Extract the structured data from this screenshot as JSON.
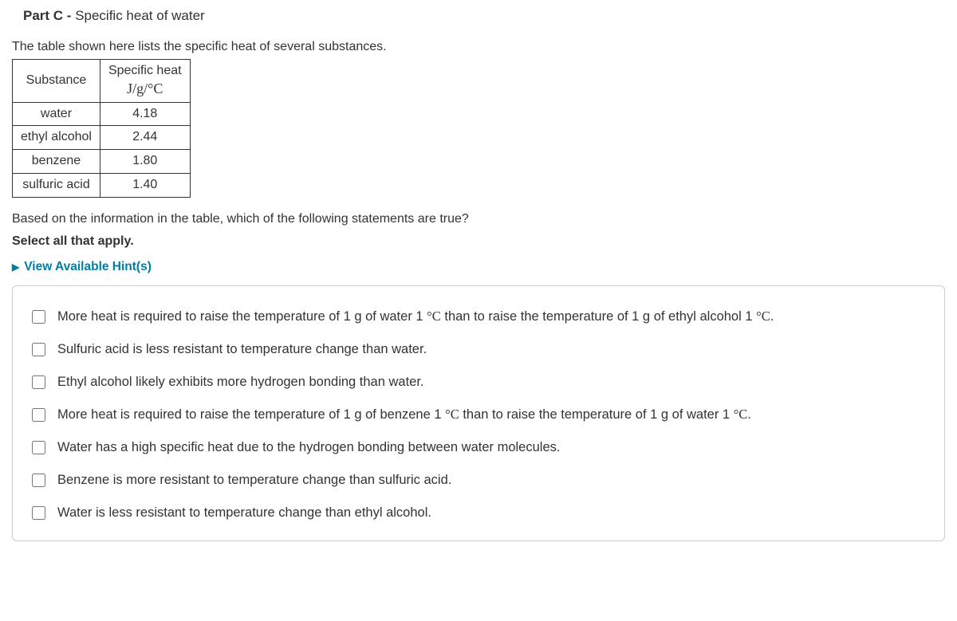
{
  "part": {
    "label": "Part C - ",
    "title": "Specific heat of water"
  },
  "intro": "The table shown here lists the specific heat of several substances.",
  "table": {
    "headers": {
      "substance": "Substance",
      "heat_line1": "Specific heat",
      "heat_unit_html": "J/g/°C"
    },
    "rows": [
      {
        "substance": "water",
        "value": "4.18"
      },
      {
        "substance": "ethyl alcohol",
        "value": "2.44"
      },
      {
        "substance": "benzene",
        "value": "1.80"
      },
      {
        "substance": "sulfuric acid",
        "value": "1.40"
      }
    ]
  },
  "question": "Based on the information in the table, which of the following statements are true?",
  "instruct": "Select all that apply.",
  "hints_label": "View Available Hint(s)",
  "options": [
    "More heat is required to raise the temperature of 1 g of water 1 °C than to raise the temperature of 1 g of ethyl alcohol 1 °C.",
    "Sulfuric acid is less resistant to temperature change than water.",
    "Ethyl alcohol likely exhibits more hydrogen bonding than water.",
    "More heat is required to raise the temperature of 1 g of benzene 1 °C than to raise the temperature of 1 g of water 1 °C.",
    "Water has a high specific heat due to the hydrogen bonding between water molecules.",
    "Benzene is more resistant to temperature change than sulfuric acid.",
    "Water is less resistant to temperature change than ethyl alcohol."
  ]
}
